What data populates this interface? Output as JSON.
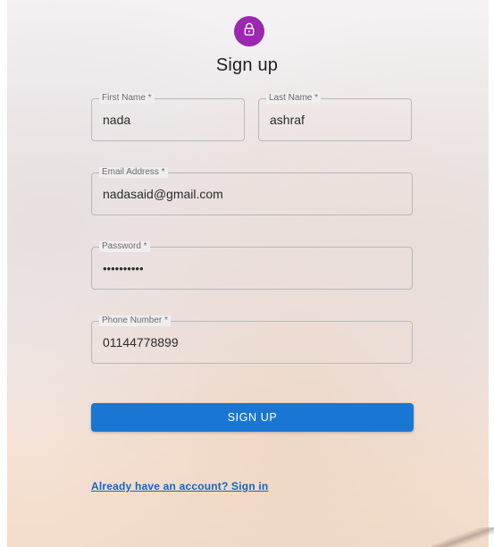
{
  "header": {
    "title": "Sign up"
  },
  "form": {
    "first_name": {
      "label": "First Name *",
      "value": "nada"
    },
    "last_name": {
      "label": "Last Name *",
      "value": "ashraf"
    },
    "email": {
      "label": "Email Address *",
      "value": "nadasaid@gmail.com"
    },
    "password": {
      "label": "Password *",
      "value": "••••••••••"
    },
    "phone": {
      "label": "Phone Number *",
      "value": "01144778899"
    },
    "submit_label": "SIGN UP",
    "signin_link": "Already have an account? Sign in"
  },
  "colors": {
    "avatar": "#9c27b0",
    "primary": "#1976d2",
    "link": "#1565c0"
  },
  "icons": {
    "avatar_icon": "lock-outlined-icon"
  }
}
